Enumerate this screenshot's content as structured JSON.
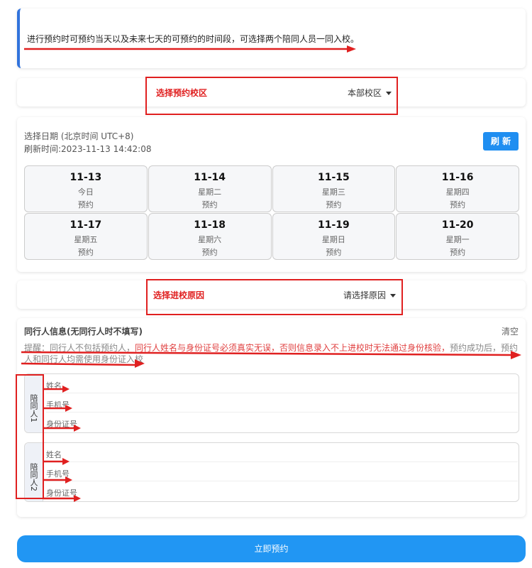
{
  "notice": {
    "text": "进行预约时可预约当天以及未来七天的可预约的时间段，可选择两个陪同人员一同入校。"
  },
  "campus": {
    "label": "选择预约校区",
    "value": "本部校区"
  },
  "date_picker": {
    "title": "选择日期 (北京时间 UTC+8)",
    "refresh_time": "刷新时间:2023-11-13 14:42:08",
    "refresh_label": "刷 新",
    "days": [
      {
        "date": "11-13",
        "weekday": "今日",
        "action": "预约"
      },
      {
        "date": "11-14",
        "weekday": "星期二",
        "action": "预约"
      },
      {
        "date": "11-15",
        "weekday": "星期三",
        "action": "预约"
      },
      {
        "date": "11-16",
        "weekday": "星期四",
        "action": "预约"
      },
      {
        "date": "11-17",
        "weekday": "星期五",
        "action": "预约"
      },
      {
        "date": "11-18",
        "weekday": "星期六",
        "action": "预约"
      },
      {
        "date": "11-19",
        "weekday": "星期日",
        "action": "预约"
      },
      {
        "date": "11-20",
        "weekday": "星期一",
        "action": "预约"
      }
    ]
  },
  "reason": {
    "label": "选择进校原因",
    "value": "请选择原因"
  },
  "companions": {
    "title": "同行人信息(无同行人时不填写)",
    "clear_label": "清空",
    "hint_prefix": "提醒：同行人不包括预约人，",
    "hint_red": "同行人姓名与身份证号必须真实无误，否则信息录入不上进校时无法通过身份核验，",
    "hint_suffix": "预约成功后，预约人和同行人均需使用身份证入校",
    "people": [
      {
        "tag": "陪同人1",
        "fields": [
          "姓名",
          "手机号",
          "身份证号"
        ]
      },
      {
        "tag": "陪同人2",
        "fields": [
          "姓名",
          "手机号",
          "身份证号"
        ]
      }
    ]
  },
  "submit_label": "立即预约",
  "colors": {
    "accent": "#2196f3",
    "annotation_red": "#e02020"
  }
}
